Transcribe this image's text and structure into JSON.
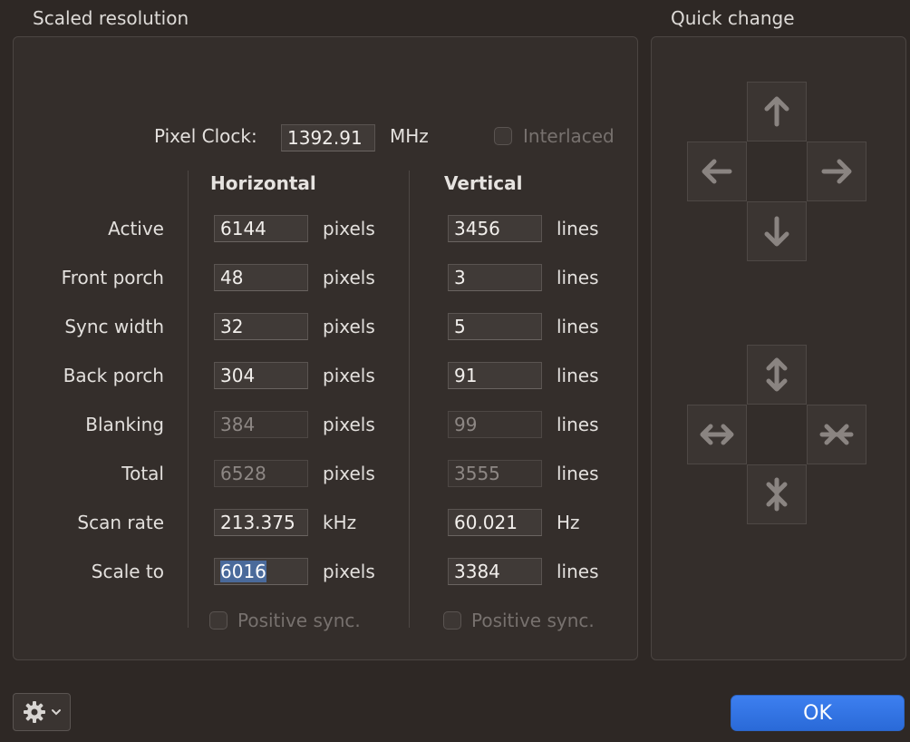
{
  "scaled": {
    "title": "Scaled resolution",
    "pixel_clock_label": "Pixel Clock:",
    "pixel_clock_value": "1392.91",
    "pixel_clock_unit": "MHz",
    "interlaced_label": "Interlaced",
    "horizontal_header": "Horizontal",
    "vertical_header": "Vertical",
    "rows": [
      {
        "label": "Active",
        "h": "6144",
        "h_unit": "pixels",
        "v": "3456",
        "v_unit": "lines"
      },
      {
        "label": "Front porch",
        "h": "48",
        "h_unit": "pixels",
        "v": "3",
        "v_unit": "lines"
      },
      {
        "label": "Sync width",
        "h": "32",
        "h_unit": "pixels",
        "v": "5",
        "v_unit": "lines"
      },
      {
        "label": "Back porch",
        "h": "304",
        "h_unit": "pixels",
        "v": "91",
        "v_unit": "lines"
      },
      {
        "label": "Blanking",
        "h": "384",
        "h_unit": "pixels",
        "v": "99",
        "v_unit": "lines"
      },
      {
        "label": "Total",
        "h": "6528",
        "h_unit": "pixels",
        "v": "3555",
        "v_unit": "lines"
      },
      {
        "label": "Scan rate",
        "h": "213.375",
        "h_unit": "kHz",
        "v": "60.021",
        "v_unit": "Hz"
      },
      {
        "label": "Scale to",
        "h": "6016",
        "h_unit": "pixels",
        "v": "3384",
        "v_unit": "lines"
      }
    ],
    "h_positive_sync": "Positive sync.",
    "v_positive_sync": "Positive sync."
  },
  "quick_change": {
    "title": "Quick change",
    "move_icons": [
      "arrow-up-icon",
      "arrow-left-icon",
      "arrow-right-icon",
      "arrow-down-icon"
    ],
    "resize_icons": [
      "expand-vertical-icon",
      "expand-horizontal-icon",
      "shrink-horizontal-icon",
      "shrink-vertical-icon"
    ]
  },
  "footer": {
    "gear_icon": "gear-icon",
    "ok_label": "OK"
  },
  "colors": {
    "background": "#2e2825",
    "accent": "#2f72e4",
    "selection": "#4a6a9b"
  }
}
